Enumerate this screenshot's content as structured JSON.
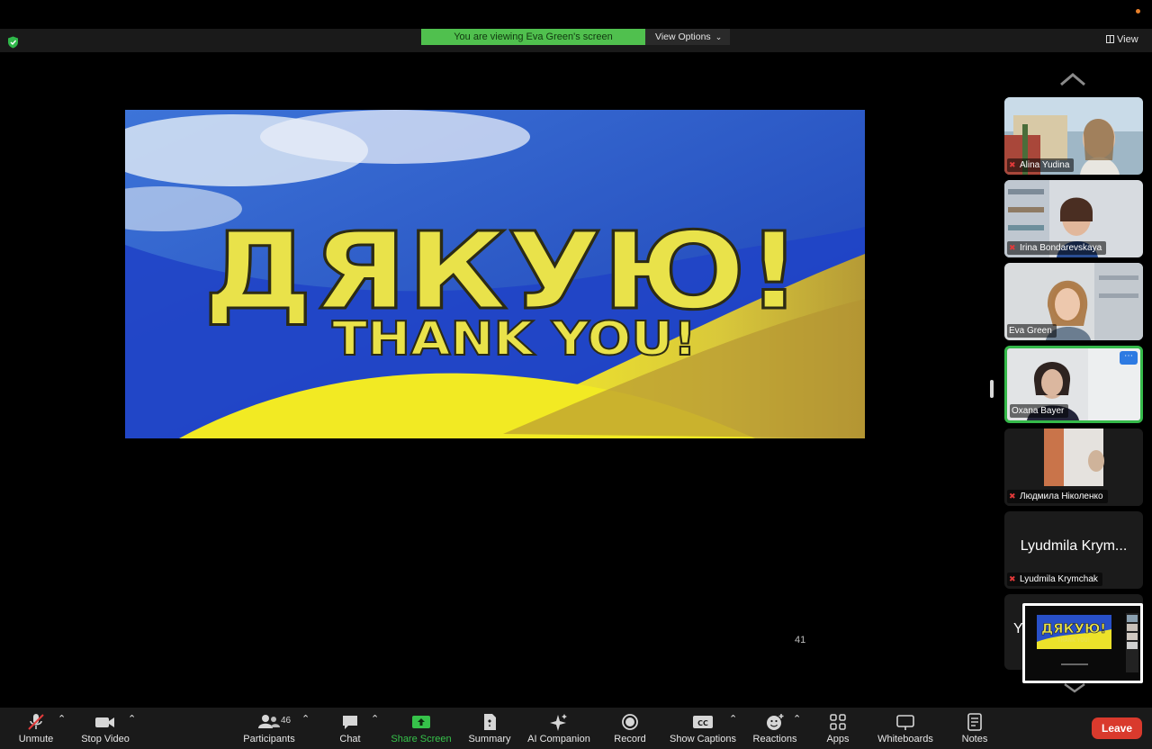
{
  "banner": {
    "viewing_text": "You are viewing Eva Green's screen",
    "view_options": "View Options",
    "view": "View"
  },
  "slide": {
    "title_ua": "ДЯКУЮ!",
    "title_en": "THANK YOU!",
    "page_number": "41"
  },
  "gallery": {
    "participants": [
      {
        "name": "Alina Yudina",
        "muted": true
      },
      {
        "name": "Irina Bondarevskaya",
        "muted": true
      },
      {
        "name": "Eva Green",
        "muted": false
      },
      {
        "name": "Oxana Bayer",
        "muted": false,
        "active_speaker": true
      },
      {
        "name": "Людмила Ніколенко",
        "muted": true
      },
      {
        "name": "Lyudmila Krymchak",
        "display_text": "Lyudmila Krym...",
        "muted": true
      }
    ]
  },
  "toolbar": {
    "unmute": "Unmute",
    "stop_video": "Stop Video",
    "participants": "Participants",
    "participants_count": "46",
    "chat": "Chat",
    "share_screen": "Share Screen",
    "summary": "Summary",
    "ai_companion": "AI Companion",
    "record": "Record",
    "show_captions": "Show Captions",
    "cc": "CC",
    "reactions": "Reactions",
    "apps": "Apps",
    "whiteboards": "Whiteboards",
    "notes": "Notes",
    "leave": "Leave"
  },
  "colors": {
    "share_green": "#50c04e",
    "active_border": "#35b94a",
    "leave_red": "#d93a2d",
    "muted_red": "#e23a3a"
  }
}
